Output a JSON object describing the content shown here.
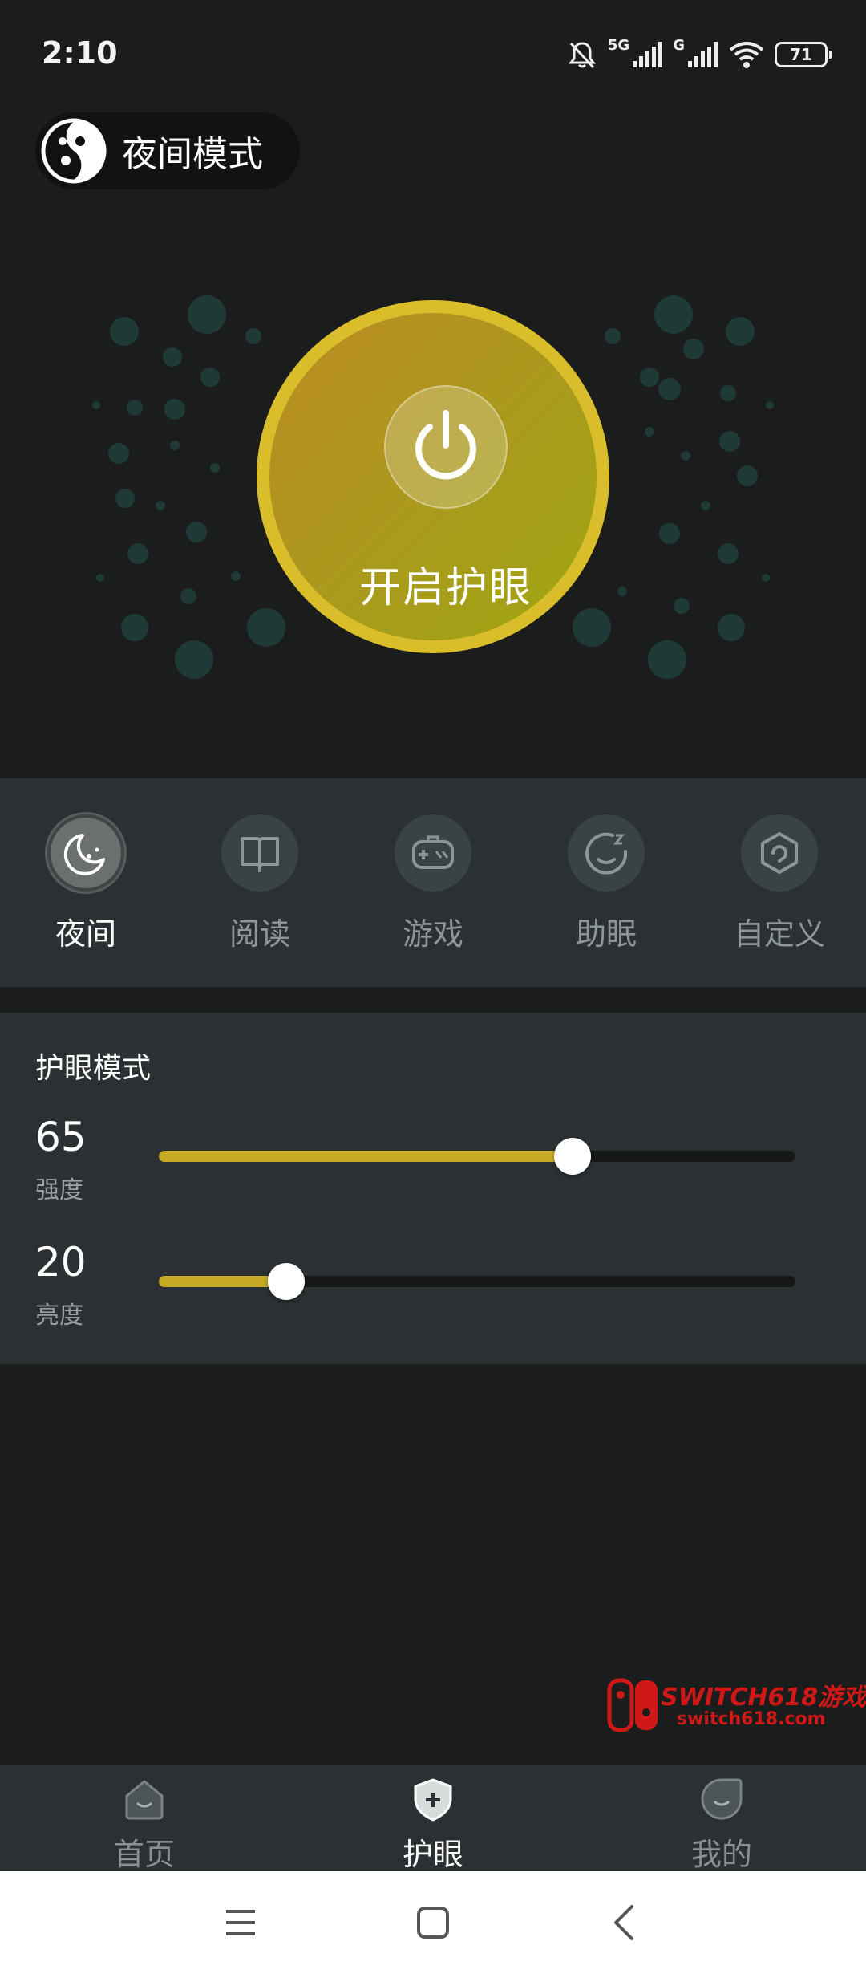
{
  "status_bar": {
    "time": "2:10",
    "signal1_label": "5G",
    "signal2_label": "G",
    "battery": "71"
  },
  "mode_pill": {
    "label": "夜间模式",
    "icon": "moon-face-icon"
  },
  "power": {
    "label": "开启护眼",
    "icon": "power-icon"
  },
  "modes": [
    {
      "label": "夜间",
      "icon": "moon-icon",
      "active": true
    },
    {
      "label": "阅读",
      "icon": "book-icon",
      "active": false
    },
    {
      "label": "游戏",
      "icon": "gamepad-icon",
      "active": false
    },
    {
      "label": "助眠",
      "icon": "sleep-icon",
      "active": false
    },
    {
      "label": "自定义",
      "icon": "hexagon-icon",
      "active": false
    }
  ],
  "eye_mode": {
    "title": "护眼模式",
    "sliders": [
      {
        "value": "65",
        "label": "强度",
        "fraction": 0.65
      },
      {
        "value": "20",
        "label": "亮度",
        "fraction": 0.2
      }
    ]
  },
  "watermark": {
    "title": "SWITCH618游戏",
    "url": "switch618.com"
  },
  "bottom_nav": [
    {
      "label": "首页",
      "icon": "home-icon",
      "active": false
    },
    {
      "label": "护眼",
      "icon": "shield-plus-icon",
      "active": true
    },
    {
      "label": "我的",
      "icon": "profile-icon",
      "active": false
    }
  ],
  "colors": {
    "background": "#1b1c1c",
    "panel": "#2b3133",
    "accent": "#c7ab25",
    "power_ring": "#d9bd2b",
    "dots": "#1f3a36"
  }
}
